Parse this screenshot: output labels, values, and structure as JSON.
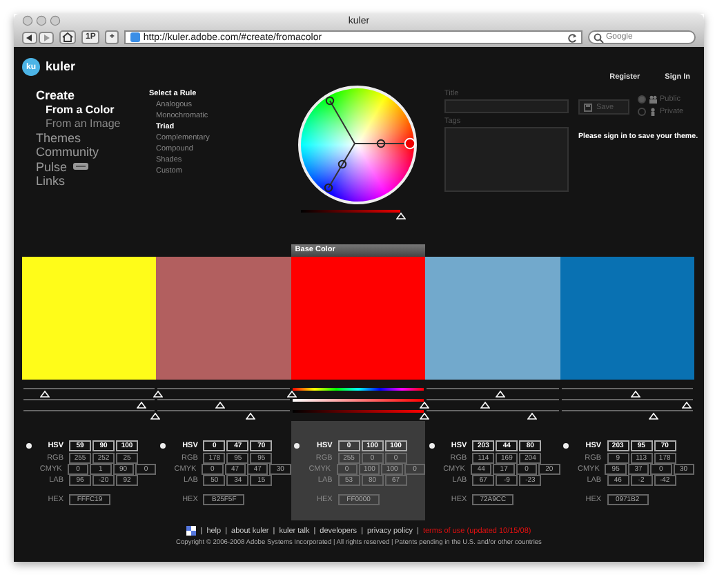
{
  "browser": {
    "title": "kuler",
    "bookmarks_button": "1P",
    "add_button": "+",
    "url": "http://kuler.adobe.com/#create/fromacolor",
    "search": {
      "placeholder": "Google"
    }
  },
  "header": {
    "logo_mark": "ku",
    "logo": "kuler",
    "links": [
      "Register",
      "Sign In"
    ]
  },
  "nav": [
    {
      "label": "Create",
      "selected": true,
      "children": [
        {
          "label": "From a Color",
          "selected": true
        },
        {
          "label": "From an Image",
          "selected": false
        }
      ]
    },
    {
      "label": "Themes",
      "selected": false
    },
    {
      "label": "Community",
      "selected": false
    },
    {
      "label": "Pulse",
      "selected": false,
      "badge": true
    },
    {
      "label": "Links",
      "selected": false
    }
  ],
  "rules": {
    "title": "Select a Rule",
    "items": [
      {
        "label": "Analogous",
        "selected": false
      },
      {
        "label": "Monochromatic",
        "selected": false
      },
      {
        "label": "Triad",
        "selected": true
      },
      {
        "label": "Complementary",
        "selected": false
      },
      {
        "label": "Compound",
        "selected": false
      },
      {
        "label": "Shades",
        "selected": false
      },
      {
        "label": "Custom",
        "selected": false
      }
    ]
  },
  "wheel": {
    "brightness": {
      "level": 1
    }
  },
  "form": {
    "title_label": "Title",
    "tags_label": "Tags",
    "save": {
      "label": "Save",
      "disabled": true
    },
    "visibility": [
      {
        "label": "Public",
        "selected": true
      },
      {
        "label": "Private",
        "selected": false
      }
    ],
    "notice": "Please sign in to save your theme."
  },
  "base_label": "Base Color",
  "swatches": [
    {
      "color": "#fffc19",
      "selected": false,
      "sliders": [
        {
          "level": 0.16
        },
        {
          "level": 0.9
        },
        {
          "level": 1
        }
      ],
      "values": [
        {
          "label": "HSV",
          "fields": [
            "59",
            "90",
            "100"
          ]
        },
        {
          "label": "RGB",
          "fields": [
            "255",
            "252",
            "25"
          ]
        },
        {
          "label": "CMYK",
          "fields": [
            "0",
            "1",
            "90",
            "0"
          ]
        },
        {
          "label": "LAB",
          "fields": [
            "96",
            "-20",
            "92"
          ]
        },
        {
          "label": "HEX",
          "fields": [
            "FFFC19"
          ]
        }
      ]
    },
    {
      "color": "#b25f5f",
      "selected": false,
      "sliders": [
        {
          "level": 0
        },
        {
          "level": 0.47
        },
        {
          "level": 0.7
        }
      ],
      "values": [
        {
          "label": "HSV",
          "fields": [
            "0",
            "47",
            "70"
          ]
        },
        {
          "label": "RGB",
          "fields": [
            "178",
            "95",
            "95"
          ]
        },
        {
          "label": "CMYK",
          "fields": [
            "0",
            "47",
            "47",
            "30"
          ]
        },
        {
          "label": "LAB",
          "fields": [
            "50",
            "34",
            "15"
          ]
        },
        {
          "label": "HEX",
          "fields": [
            "B25F5F"
          ]
        }
      ]
    },
    {
      "color": "#ff0000",
      "selected": true,
      "sliders": [
        {
          "level": 0
        },
        {
          "level": 1
        },
        {
          "level": 1
        }
      ],
      "values": [
        {
          "label": "HSV",
          "fields": [
            "0",
            "100",
            "100"
          ]
        },
        {
          "label": "RGB",
          "fields": [
            "255",
            "0",
            "0"
          ]
        },
        {
          "label": "CMYK",
          "fields": [
            "0",
            "100",
            "100",
            "0"
          ]
        },
        {
          "label": "LAB",
          "fields": [
            "53",
            "80",
            "67"
          ]
        },
        {
          "label": "HEX",
          "fields": [
            "FF0000"
          ]
        }
      ]
    },
    {
      "color": "#72a9cc",
      "selected": false,
      "sliders": [
        {
          "level": 0.56
        },
        {
          "level": 0.44
        },
        {
          "level": 0.8
        }
      ],
      "values": [
        {
          "label": "HSV",
          "fields": [
            "203",
            "44",
            "80"
          ]
        },
        {
          "label": "RGB",
          "fields": [
            "114",
            "169",
            "204"
          ]
        },
        {
          "label": "CMYK",
          "fields": [
            "44",
            "17",
            "0",
            "20"
          ]
        },
        {
          "label": "LAB",
          "fields": [
            "67",
            "-9",
            "-23"
          ]
        },
        {
          "label": "HEX",
          "fields": [
            "72A9CC"
          ]
        }
      ]
    },
    {
      "color": "#0971b2",
      "selected": false,
      "sliders": [
        {
          "level": 0.56
        },
        {
          "level": 0.95
        },
        {
          "level": 0.7
        }
      ],
      "values": [
        {
          "label": "HSV",
          "fields": [
            "203",
            "95",
            "70"
          ]
        },
        {
          "label": "RGB",
          "fields": [
            "9",
            "113",
            "178"
          ]
        },
        {
          "label": "CMYK",
          "fields": [
            "95",
            "37",
            "0",
            "30"
          ]
        },
        {
          "label": "LAB",
          "fields": [
            "46",
            "-2",
            "-42"
          ]
        },
        {
          "label": "HEX",
          "fields": [
            "0971B2"
          ]
        }
      ]
    }
  ],
  "footer": {
    "separator": "|",
    "links": [
      {
        "label": "help",
        "kind": "plain"
      },
      {
        "label": "about kuler",
        "kind": "plain"
      },
      {
        "label": "kuler talk",
        "kind": "plain"
      },
      {
        "label": "developers",
        "kind": "plain"
      },
      {
        "label": "privacy policy",
        "kind": "plain"
      },
      {
        "label": "terms of use (updated 10/15/08)",
        "kind": "alert"
      }
    ],
    "copyright": "Copyright © 2006-2008 Adobe Systems Incorporated | All rights reserved | Patents pending in the U.S. and/or other countries"
  }
}
